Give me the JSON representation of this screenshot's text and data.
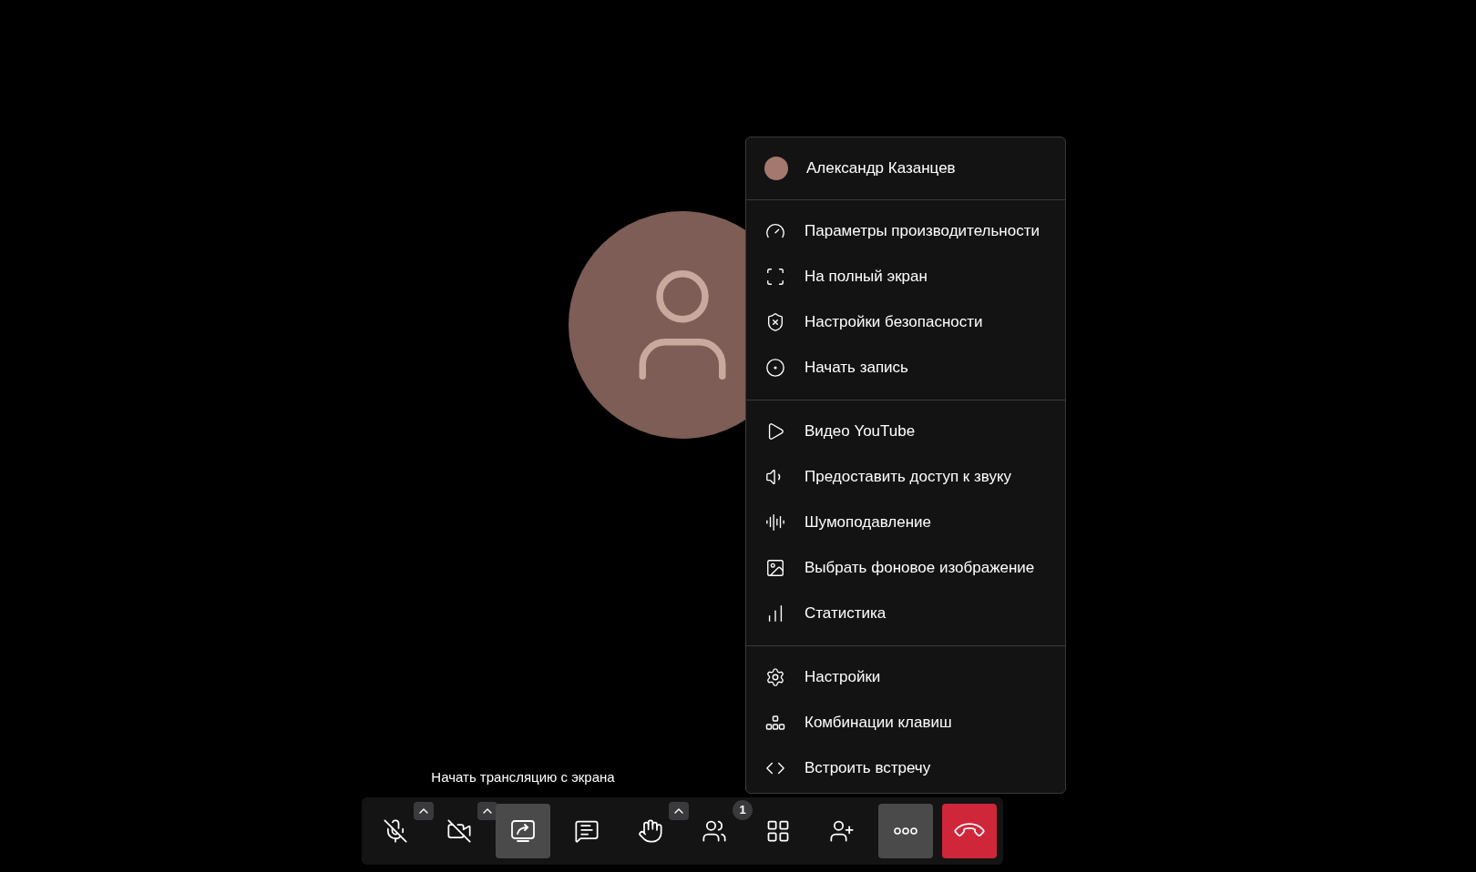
{
  "menu": {
    "header": {
      "name": "Александр Казанцев"
    },
    "sections": [
      {
        "items": [
          {
            "label": "Параметры производительности"
          },
          {
            "label": "На полный экран"
          },
          {
            "label": "Настройки безопасности"
          },
          {
            "label": "Начать запись"
          }
        ]
      },
      {
        "items": [
          {
            "label": "Видео YouTube"
          },
          {
            "label": "Предоставить доступ к звуку"
          },
          {
            "label": "Шумоподавление"
          },
          {
            "label": "Выбрать фоновое изображение"
          },
          {
            "label": "Статистика"
          }
        ]
      },
      {
        "items": [
          {
            "label": "Настройки"
          },
          {
            "label": "Комбинации клавиш"
          },
          {
            "label": "Встроить встречу"
          }
        ]
      }
    ]
  },
  "toolbar": {
    "buttons": [
      {
        "kind": "mic",
        "active": false,
        "has_menu": true
      },
      {
        "kind": "camera",
        "active": false,
        "has_menu": true
      },
      {
        "kind": "share",
        "active": true,
        "has_menu": false,
        "tooltip": "Начать трансляцию с экрана"
      },
      {
        "kind": "chat",
        "active": false,
        "has_menu": false
      },
      {
        "kind": "hand",
        "active": false,
        "has_menu": true
      },
      {
        "kind": "participants",
        "active": false,
        "has_menu": false,
        "badge": "1"
      },
      {
        "kind": "grid",
        "active": false,
        "has_menu": false
      },
      {
        "kind": "invite",
        "active": false,
        "has_menu": false
      },
      {
        "kind": "more",
        "active": true,
        "has_menu": false
      },
      {
        "kind": "hangup",
        "active": false,
        "has_menu": false
      }
    ]
  }
}
